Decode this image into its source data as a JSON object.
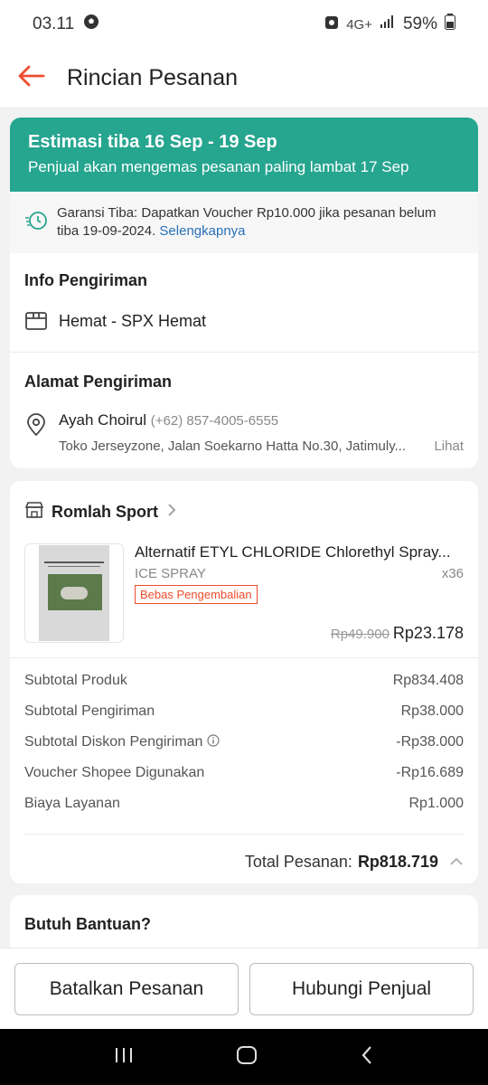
{
  "status_bar": {
    "time": "03.11",
    "network": "4G+",
    "battery": "59%"
  },
  "header": {
    "title": "Rincian Pesanan"
  },
  "estimate": {
    "title": "Estimasi tiba 16 Sep - 19 Sep",
    "subtitle": "Penjual akan mengemas pesanan paling lambat 17 Sep"
  },
  "guarantee": {
    "text_line1": "Garansi Tiba: Dapatkan Voucher Rp10.000 jika pesanan belum",
    "text_line2": "tiba 19-09-2024.",
    "link": "Selengkapnya"
  },
  "shipping_info": {
    "title": "Info Pengiriman",
    "method": "Hemat - SPX Hemat"
  },
  "address": {
    "title": "Alamat Pengiriman",
    "name": "Ayah Choirul",
    "phone": "(+62) 857-4005-6555",
    "detail": "Toko Jerseyzone, Jalan Soekarno Hatta No.30, Jatimuly...",
    "more": "Lihat"
  },
  "shop": {
    "name": "Romlah Sport"
  },
  "product": {
    "name": "Alternatif ETYL CHLORIDE Chlorethyl Spray...",
    "variant": "ICE SPRAY",
    "qty": "x36",
    "badge": "Bebas Pengembalian",
    "original_price": "Rp49.900",
    "price": "Rp23.178"
  },
  "summary": {
    "rows": [
      {
        "label": "Subtotal Produk",
        "value": "Rp834.408"
      },
      {
        "label": "Subtotal Pengiriman",
        "value": "Rp38.000"
      },
      {
        "label": "Subtotal Diskon Pengiriman",
        "value": "-Rp38.000"
      },
      {
        "label": "Voucher Shopee Digunakan",
        "value": "-Rp16.689"
      },
      {
        "label": "Biaya Layanan",
        "value": "Rp1.000"
      }
    ],
    "total_label": "Total Pesanan:",
    "total_value": "Rp818.719"
  },
  "help": {
    "title": "Butuh Bantuan?"
  },
  "actions": {
    "cancel": "Batalkan Pesanan",
    "contact": "Hubungi Penjual"
  },
  "colors": {
    "accent": "#ee4d2d",
    "banner": "#26a58f",
    "link": "#2a6fb7"
  }
}
